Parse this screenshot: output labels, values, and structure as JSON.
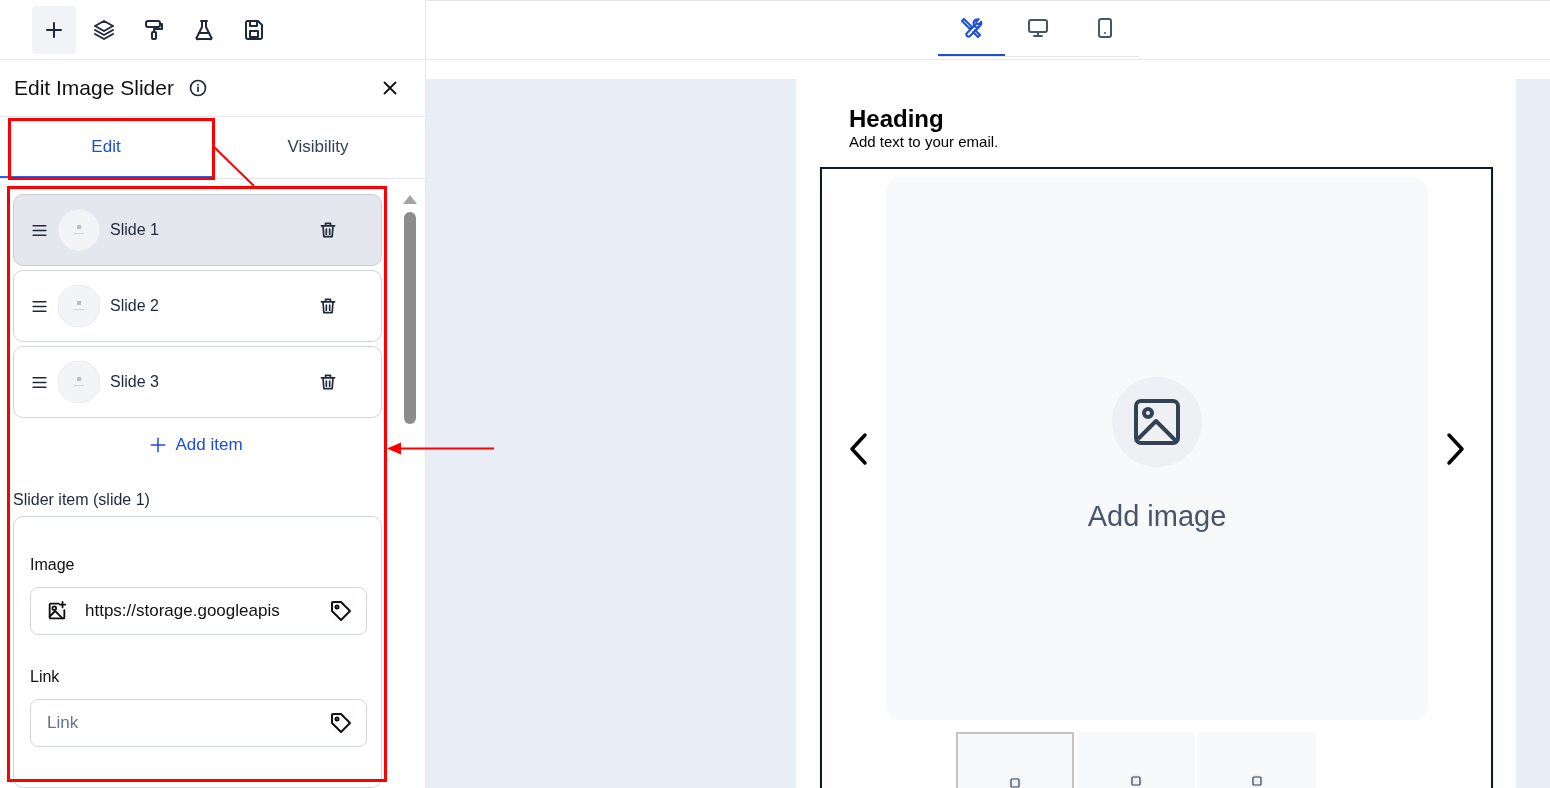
{
  "toolbar": {
    "tools": [
      {
        "kind": "add",
        "selected": true
      },
      {
        "kind": "layers",
        "selected": false
      },
      {
        "kind": "style",
        "selected": false
      },
      {
        "kind": "test",
        "selected": false
      },
      {
        "kind": "save",
        "selected": false
      }
    ]
  },
  "view_tabs": [
    {
      "kind": "tools",
      "selected": true
    },
    {
      "kind": "desktop",
      "selected": false
    },
    {
      "kind": "mobile",
      "selected": false
    }
  ],
  "panel": {
    "title": "Edit Image Slider",
    "tabs": [
      {
        "label": "Edit",
        "selected": true
      },
      {
        "label": "Visibility",
        "selected": false
      }
    ],
    "slides": [
      {
        "label": "Slide 1",
        "selected": true
      },
      {
        "label": "Slide 2",
        "selected": false
      },
      {
        "label": "Slide 3",
        "selected": false
      }
    ],
    "add_item": "Add item",
    "section_label": "Slider item (slide 1)",
    "image_field": {
      "label": "Image",
      "value": "https://storage.googleapis"
    },
    "link_field": {
      "label": "Link",
      "placeholder": "Link"
    }
  },
  "preview": {
    "heading": "Heading",
    "text": "Add text to your email.",
    "add_image": "Add image",
    "thumbnails": [
      {
        "selected": true
      },
      {
        "selected": false
      },
      {
        "selected": false
      }
    ]
  }
}
